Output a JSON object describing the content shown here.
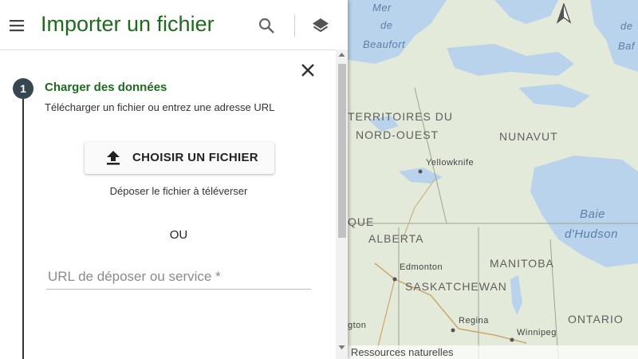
{
  "panel": {
    "title": "Importer un fichier",
    "step": {
      "number": "1",
      "title": "Charger des données",
      "subtitle": "Télécharger un fichier ou entrez une adresse URL"
    },
    "choose_file_label": "CHOISIR UN FICHIER",
    "drop_text": "Déposer le fichier à téléverser",
    "or_text": "OU",
    "url_placeholder": "URL de déposer ou service *"
  },
  "header": {
    "icons": [
      "menu-icon",
      "search-icon",
      "layers-icon"
    ]
  },
  "map": {
    "labels": {
      "mer": "Mer",
      "de": "de",
      "beaufort": "Beaufort",
      "de_right": "de",
      "baf": "Baf",
      "territoires": "TERRITOIRES DU",
      "nord_ouest": "NORD-OUEST",
      "nunavut": "NUNAVUT",
      "yellowknife": "Yellowknife",
      "baie": "Baie",
      "dhudson": "d'Hudson",
      "que": "QUE",
      "alberta": "ALBERTA",
      "edmonton": "Edmonton",
      "manitoba": "MANITOBA",
      "saskatchewan": "SASKATCHEWAN",
      "regina": "Regina",
      "winnipeg": "Winnipeg",
      "ontario": "ONTARIO",
      "gton": "gton"
    },
    "attribution": "© Sa Majesté la Reine du Chef du Canada, représentée par le ministre des Ressources naturelles",
    "colors": {
      "land": "#e3ead9",
      "water": "#b9d3ec",
      "panel_accent": "#1e6b1e"
    }
  }
}
